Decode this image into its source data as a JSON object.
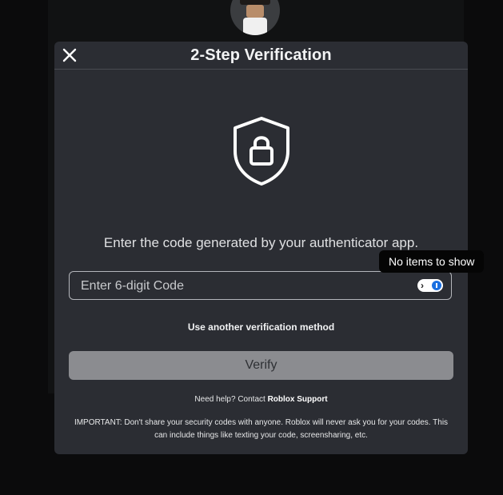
{
  "modal": {
    "title": "2-Step Verification",
    "close_icon": "close-icon",
    "shield_icon": "shield-lock-icon"
  },
  "form": {
    "instruction": "Enter the code generated by your authenticator app.",
    "code_placeholder": "Enter 6-digit Code",
    "code_value": "",
    "password_manager_icon": "password-manager-icon",
    "tooltip": "No items to show",
    "alt_method_label": "Use another verification method",
    "verify_label": "Verify"
  },
  "footer": {
    "help_prefix": "Need help? Contact ",
    "help_link": "Roblox Support",
    "important_text": "IMPORTANT: Don't share your security codes with anyone. Roblox will never ask you for your codes. This can include things like texting your code, screensharing, etc."
  },
  "colors": {
    "modal_bg": "#2b2d33",
    "verify_disabled": "#8b8c90",
    "page_bg": "#0b0b0c"
  }
}
